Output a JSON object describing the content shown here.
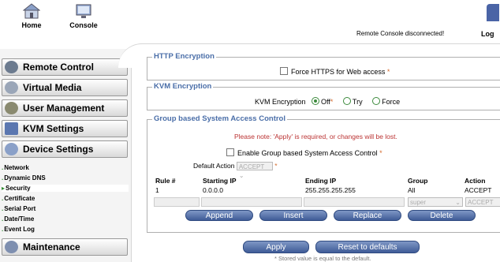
{
  "topbar": {
    "home_label": "Home",
    "console_label": "Console",
    "status_text": "Remote Console disconnected!",
    "logout_label": "Log"
  },
  "sidebar": {
    "nav": [
      {
        "label": "Remote Control"
      },
      {
        "label": "Virtual Media"
      },
      {
        "label": "User Management"
      },
      {
        "label": "KVM Settings"
      },
      {
        "label": "Device Settings"
      }
    ],
    "subitems": [
      "Network",
      "Dynamic DNS",
      "Security",
      "Certificate",
      "Serial Port",
      "Date/Time",
      "Event Log"
    ],
    "selected": "Security",
    "maintenance_label": "Maintenance"
  },
  "http": {
    "legend": "HTTP Encryption",
    "force_https_label": "Force HTTPS for Web access",
    "asterisk": "*"
  },
  "kvm": {
    "legend": "KVM Encryption",
    "label": "KVM Encryption",
    "options": [
      "Off",
      "Try",
      "Force"
    ],
    "selected": "Off",
    "off_asterisk": "*"
  },
  "group": {
    "legend": "Group based System Access Control",
    "note": "Please note: 'Apply' is required, or changes will be lost.",
    "enable_label": "Enable Group based System Access Control",
    "asterisk": "*",
    "default_action_label": "Default Action",
    "default_action_value": "ACCEPT",
    "columns": [
      "Rule #",
      "Starting IP",
      "Ending IP",
      "Group",
      "Action"
    ],
    "rows": [
      {
        "rule": "1",
        "start": "0.0.0.0",
        "end": "255.255.255.255",
        "group": "All",
        "action": "ACCEPT"
      }
    ],
    "new_group_value": "super",
    "new_action_value": "ACCEPT",
    "buttons": {
      "append": "Append",
      "insert": "Insert",
      "replace": "Replace",
      "delete": "Delete"
    }
  },
  "footer": {
    "apply_label": "Apply",
    "reset_label": "Reset to defaults",
    "footnote": "* Stored value is equal to the default."
  }
}
